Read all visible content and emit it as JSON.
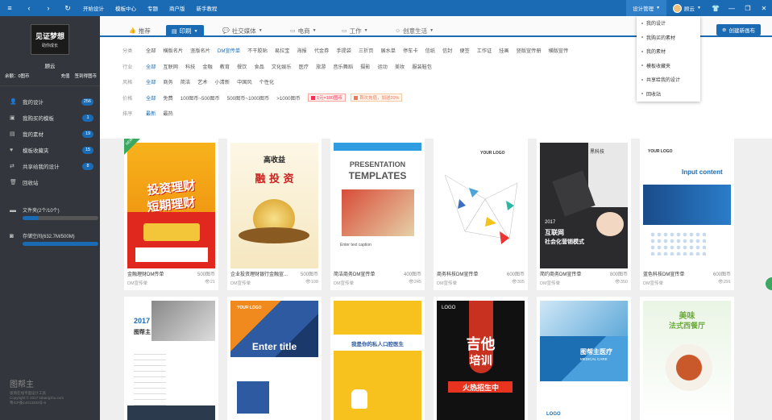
{
  "topbar": {
    "nav": [
      "开始设计",
      "模板中心",
      "专题",
      "商户版",
      "新手教程"
    ],
    "manage_label": "设计管理",
    "user_name": "顾云"
  },
  "dropdown": {
    "items": [
      "我的设计",
      "我购买的素材",
      "我的素材",
      "模板收藏夹",
      "共享给我的设计",
      "回收站"
    ]
  },
  "sidebar": {
    "avatar_title": "见证梦想",
    "avatar_sub": "助你成长",
    "username": "顾云",
    "balance": "余额：0图币",
    "recharge": "充值",
    "invoice": "签到得图币",
    "menu": [
      {
        "icon": "user-icon",
        "label": "我的设计",
        "count": "256"
      },
      {
        "icon": "cart-icon",
        "label": "我购买的模板",
        "count": "1"
      },
      {
        "icon": "box-icon",
        "label": "我的素材",
        "count": "19"
      },
      {
        "icon": "heart-icon",
        "label": "模板收藏夹",
        "count": "15"
      },
      {
        "icon": "share-icon",
        "label": "共享给我的设计",
        "count": "8"
      },
      {
        "icon": "trash-icon",
        "label": "回收站",
        "count": ""
      }
    ],
    "folder_label": "文件夹(2个/10个)",
    "folder_progress": 0.2,
    "storage_label": "存储空间(632.7M/500M)",
    "storage_progress": 1.0,
    "footer_brand": "图帮主",
    "footer_lines": [
      "极简在线平面设计工具",
      "Copyright © 2017 tubangzhu.com",
      "粤ICP备14013302号-6"
    ]
  },
  "tabs": [
    {
      "icon": "thumb-icon",
      "label": "推荐",
      "active": false
    },
    {
      "icon": "print-icon",
      "label": "印刷",
      "active": true
    },
    {
      "icon": "social-icon",
      "label": "社交媒体",
      "active": false
    },
    {
      "icon": "ecom-icon",
      "label": "电商",
      "active": false
    },
    {
      "icon": "work-icon",
      "label": "工作",
      "active": false
    },
    {
      "icon": "life-icon",
      "label": "创意生活",
      "active": false
    }
  ],
  "create_label": "创建新画布",
  "filters": {
    "category": {
      "label": "分类",
      "options": [
        "全部",
        "横版名片",
        "竖版名片",
        "DM宣传单",
        "不干胶贴",
        "易拉宝",
        "海报",
        "代金券",
        "手提袋",
        "三折页",
        "展水单",
        "停车卡",
        "信纸",
        "信封",
        "便签",
        "工作证",
        "挂画",
        "竖版宣传册",
        "横版宣传"
      ],
      "selected": 3
    },
    "industry": {
      "label": "行业",
      "options": [
        "全部",
        "互联网",
        "科技",
        "金融",
        "教育",
        "餐饮",
        "食品",
        "文化娱乐",
        "医疗",
        "旅游",
        "音乐舞蹈",
        "摄影",
        "运动",
        "美妆",
        "服装鞋包"
      ],
      "selected": 0
    },
    "style": {
      "label": "风格",
      "options": [
        "全部",
        "商务",
        "简洁",
        "艺术",
        "小清新",
        "中国风",
        "个性化"
      ],
      "selected": 0
    },
    "price": {
      "label": "价格",
      "options": [
        "全部",
        "免费",
        "100图币~500图币",
        "500图币~1000图币",
        ">1000图币"
      ],
      "selected": 0,
      "promo1": "1元=100图币",
      "promo2": "首次充值，加送20%"
    },
    "sort": {
      "label": "排序",
      "options": [
        "最新",
        "最热"
      ],
      "selected": 0
    }
  },
  "cards": [
    {
      "name": "金融理财DM传单",
      "price": "500图币",
      "cat": "DM宣传单",
      "views": "21",
      "new": true,
      "theme": "finance"
    },
    {
      "name": "企业投资理财银行金融宣...",
      "price": "500图币",
      "cat": "DM宣传单",
      "views": "108",
      "theme": "gold"
    },
    {
      "name": "简洁商务DM宣传单",
      "price": "400图币",
      "cat": "DM宣传单",
      "views": "245",
      "theme": "present"
    },
    {
      "name": "商务科技DM宣传单",
      "price": "600图币",
      "cat": "DM宣传单",
      "views": "305",
      "theme": "tech"
    },
    {
      "name": "简约商务DM宣传单",
      "price": "800图币",
      "cat": "DM宣传单",
      "views": "350",
      "theme": "dark"
    },
    {
      "name": "蓝色科技DM宣传单",
      "price": "600图币",
      "cat": "DM宣传单",
      "views": "291",
      "theme": "blue"
    },
    {
      "name": "",
      "theme": "laptop"
    },
    {
      "name": "",
      "theme": "enter"
    },
    {
      "name": "",
      "theme": "dental"
    },
    {
      "name": "",
      "theme": "guitar"
    },
    {
      "name": "",
      "theme": "medical"
    },
    {
      "name": "",
      "theme": "food"
    }
  ],
  "poster_text": {
    "finance_1": "投资理财",
    "finance_2": "短期理财",
    "gold_top": "高收益",
    "gold_main": "融 投 资",
    "present_1": "PRESENTATION",
    "present_2": "TEMPLATES",
    "present_caption": "Enter text caption",
    "tech_logo": "YOUR LOGO",
    "dark_line1": "2017",
    "dark_line2": "互联网",
    "dark_line3": "社会化营销模式",
    "dark_brand": "黑科技",
    "blue_title": "Input content",
    "blue_logo": "YOUR LOGO",
    "laptop_year": "2017",
    "laptop_title": "图帮主",
    "enter_logo": "YOUR LOGO",
    "enter_title": "Enter title",
    "dental_title": "我是你的私人口腔医生",
    "guitar_logo": "LOGO",
    "guitar_main": "吉他",
    "guitar_sub": "培训",
    "guitar_banner": "火热招生中",
    "medical_title": "图帮主医疗",
    "medical_sub": "MEDICAL CARE",
    "medical_logo": "LOGO",
    "food_title": "美味",
    "food_sub": "法式西餐厅"
  },
  "colors": {
    "brand_blue": "#1a6bb3",
    "sidebar_bg": "#33373d",
    "accent_green": "#3aa860"
  }
}
